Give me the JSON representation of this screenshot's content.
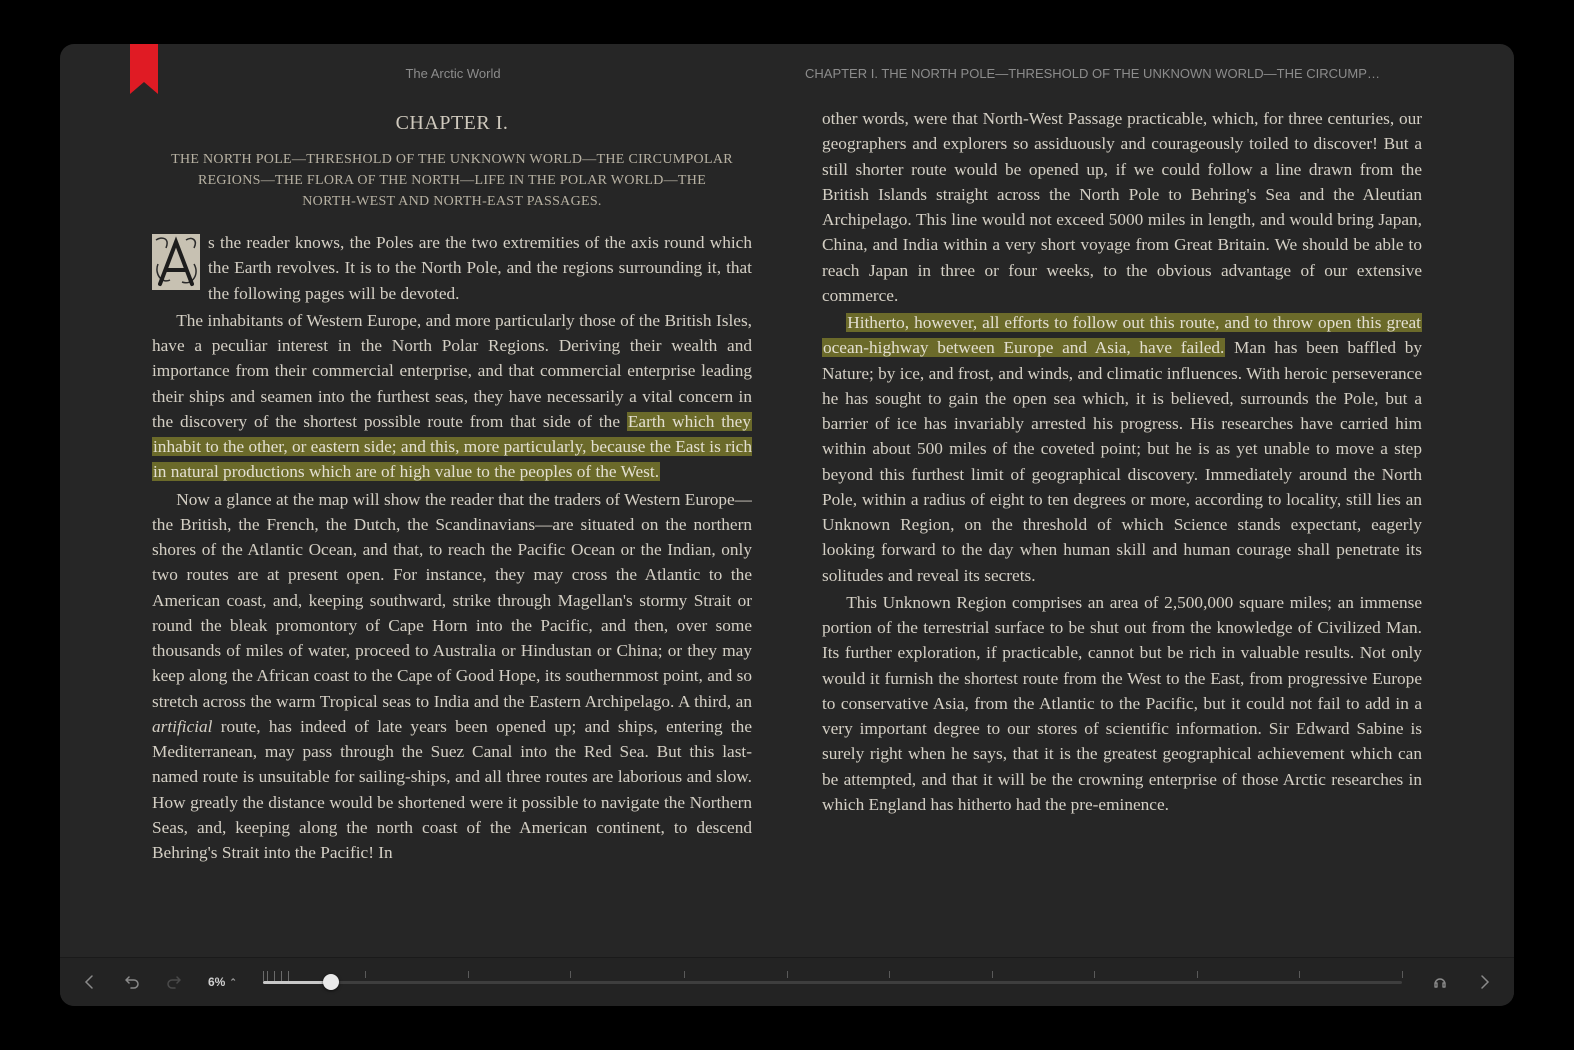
{
  "book": {
    "title": "The Arctic World",
    "running_head_right": "CHAPTER I. THE NORTH POLE—THRESHOLD OF THE UNKNOWN WORLD—THE CIRCUMPOLAR REGIONS…"
  },
  "chapter": {
    "number_label": "CHAPTER I.",
    "title": "THE NORTH POLE—THRESHOLD OF THE UNKNOWN WORLD—THE CIRCUMPOLAR REGIONS—THE FLORA OF THE NORTH—LIFE IN THE POLAR WORLD—THE NORTH-WEST AND NORTH-EAST PASSAGES."
  },
  "left_page": {
    "p1_after_cap": "s the reader knows, the Poles are the two extremities of the axis round which the Earth revolves. It is to the North Pole, and the re­gions surrounding it, that the following pages will be devoted.",
    "p2_pre": "The inhabitants of Western Europe, and more particularly those of the British Isles, have a peculiar interest in the North Polar Regions. Deriving their wealth and importance from their commercial enterprise, and that commercial enterprise leading their ships and seamen into the furthest seas, they have necessarily a vital concern in the discovery of the shortest possible route from that side of the ",
    "p2_hl": "Earth which they inhabit to the other, or eastern side; and this, more particularly, because the East is rich in natural productions which are of high value to the peoples of the West.",
    "p3_pre": "Now a glance at the map will show the reader that the traders of Western Europe—the British, the French, the Dutch, the Scandinavians—are situated on the northern shores of the Atlantic Ocean, and that, to reach the Pacific Ocean or the Indian, only two routes are at present open. For instance, they may cross the Atlantic to the American coast, and, keeping southward, strike through Magellan's stormy Strait or round the bleak promontory of Cape Horn into the Pacific, and then, over some thousands of miles of water, proceed to Australia or Hindustan or China; or they may keep along the African coast to the Cape of Good Hope, its southernmost point, and so stretch across the warm Tropical seas to India and the Eastern Archipelago. A third, an ",
    "p3_it": "artificial",
    "p3_post": " route, has indeed of late years been opened up; and ships, entering the Mediter­ranean, may pass through the Suez Canal into the Red Sea. But this last-named route is unsuitable for sailing-ships, and all three routes are labor­ious and slow. How greatly the distance would be shortened were it pos­sible to navigate the Northern Seas, and, keeping along the north coast of the American continent, to descend Behring's Strait into the Pacific! In"
  },
  "right_page": {
    "p1": "other words, were that North-West Passage practicable, which, for three centuries, our geographers and explorers so assiduously and cour­ageously toiled to discover! But a still shorter route would be opened up, if we could follow a line drawn from the British Islands straight across the North Pole to Behring's Sea and the Aleutian Archipelago. This line would not exceed 5000 miles in length, and would bring Japan, China, and India within a very short voyage from Great Britain. We should be able to reach Japan in three or four weeks, to the obvious advantage of our extensive commerce.",
    "p2_hl": "Hitherto, however, all efforts to follow out this route, and to throw open this great ocean-highway between Europe and Asia, have failed.",
    "p2_post": " Man has been baffled by Nature; by ice, and frost, and winds, and cli­matic influences. With heroic perseverance he has sought to gain the open sea which, it is believed, surrounds the Pole, but a barrier of ice has invariably arrested his progress. His researches have carried him within about 500 miles of the coveted point; but he is as yet unable to move a step beyond this furthest limit of geographical discovery. Immediately around the North Pole, within a radius of eight to ten degrees or more, according to locality, still lies an Unknown Region, on the threshold of which Science stands expectant, eagerly looking forward to the day when human skill and human courage shall penetrate its solitudes and reveal its secrets.",
    "p3": "This Unknown Region comprises an area of 2,500,000 square miles; an immense portion of the terrestrial surface to be shut out from the knowledge of Civilized Man. Its further exploration, if practicable, cannot but be rich in valuable results. Not only would it furnish the shortest route from the West to the East, from progressive Europe to conservative Asia, from the Atlantic to the Pacific, but it could not fail to add in a very important degree to our stores of scientific information. Sir Edward Sabine is surely right when he says, that it is the greatest geographical achievement which can be attempted, and that it will be the crowning en­terprise of those Arctic researches in which England has hitherto had the pre-eminence."
  },
  "progress": {
    "percent_label": "6%",
    "percent_value": 6,
    "ticks": [
      0,
      0.4,
      1.0,
      1.6,
      2.2,
      9,
      18,
      27,
      37,
      46,
      55,
      64,
      73,
      82,
      91,
      100
    ]
  },
  "highlight_color": "#6b6a2a",
  "bookmark_color": "#e01b24"
}
